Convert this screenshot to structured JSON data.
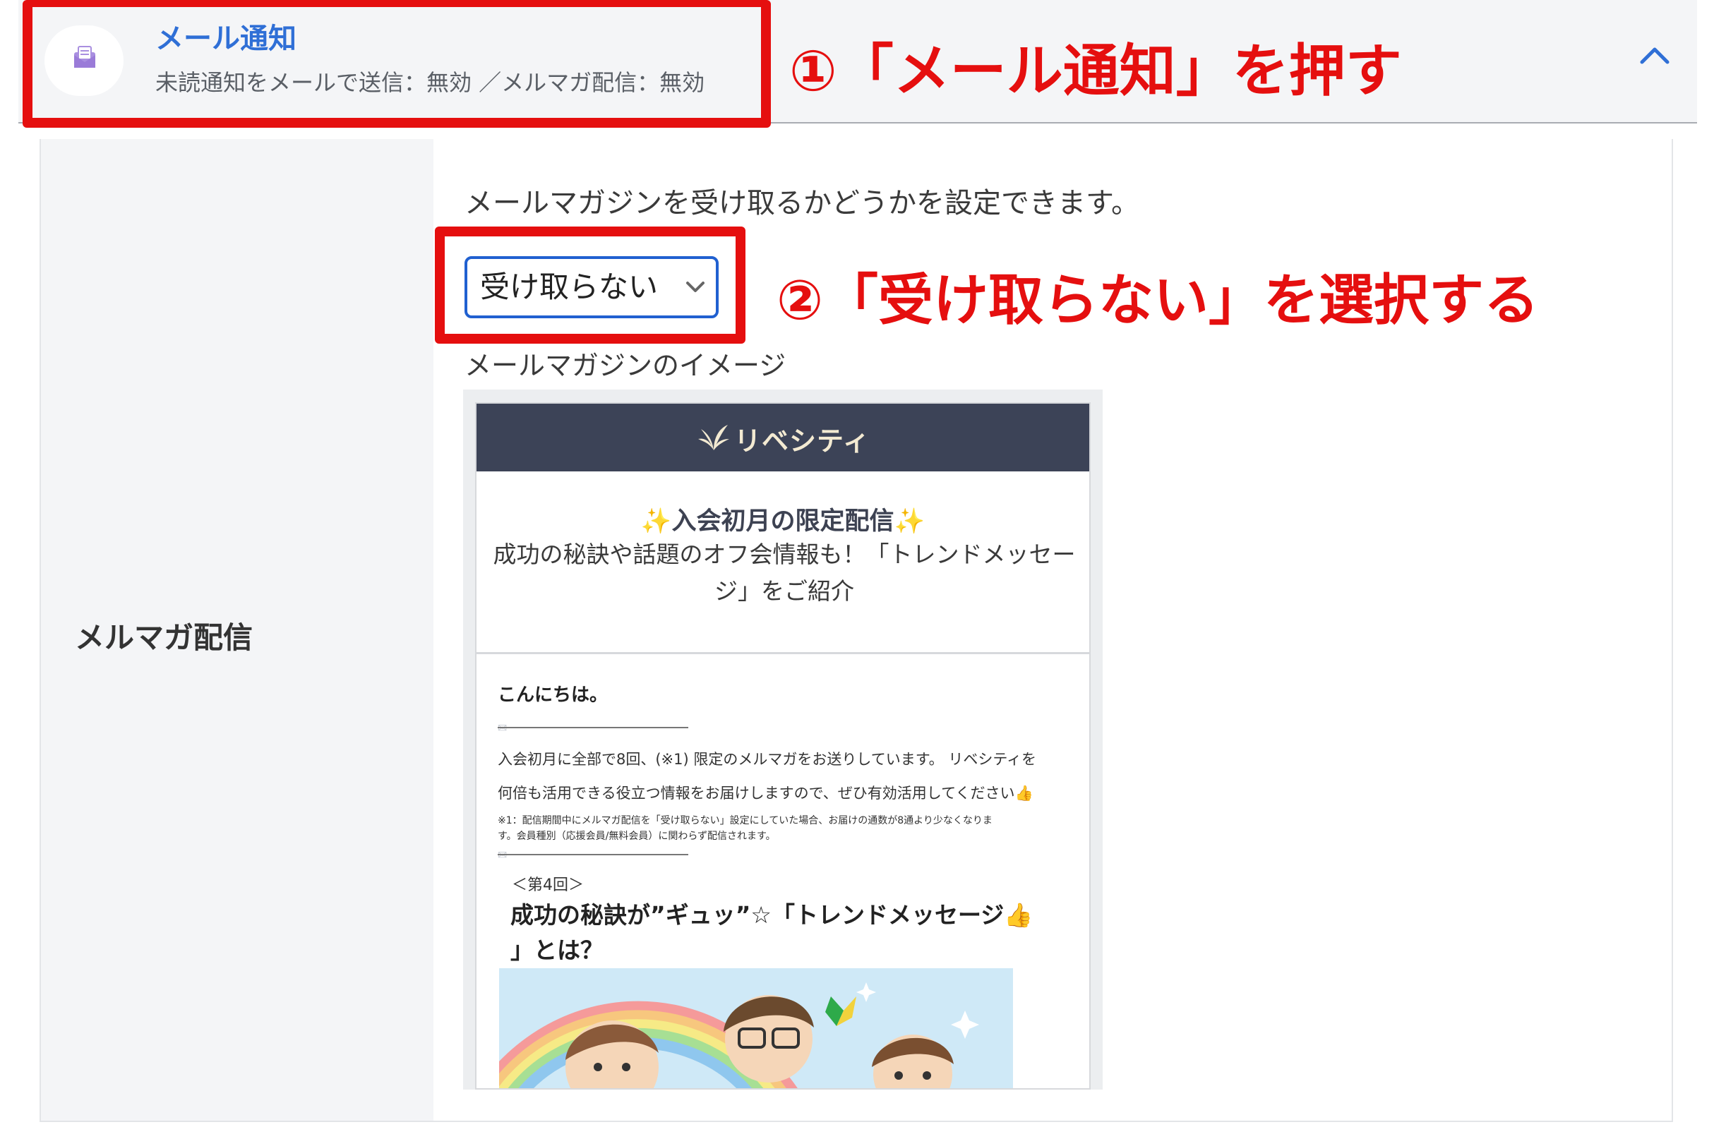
{
  "accordion": {
    "title": "メール通知",
    "subtitle": "未読通知をメールで送信：無効 ／メルマガ配信：無効"
  },
  "annotations": {
    "step1": "①「メール通知」を押す",
    "step2": "②「受け取らない」を選択する",
    "color": "#e50f0f"
  },
  "newsletter": {
    "label": "メルマガ配信",
    "description": "メールマガジンを受け取るかどうかを設定できます。",
    "select_value": "受け取らない",
    "image_caption": "メールマガジンのイメージ"
  },
  "preview": {
    "logo_text": "リベシティ",
    "headline": "✨入会初月の限定配信✨",
    "subtitle": "成功の秘訣や話題のオフ会情報も！「トレンドメッセージ」をご紹介",
    "greeting": "こんにちは。",
    "body_line1": "入会初月に全部で8回、(※1) 限定のメルマガをお送りしています。 リベシティを",
    "body_line2": "何倍も活用できる役立つ情報をお届けしますので、ぜひ有効活用してください👍",
    "note_line1": "※1：配信期間中にメルマガ配信を「受け取らない」設定にしていた場合、お届けの通数が8通より少なくなりま",
    "note_line2": "す。会員種別（応援会員/無料会員）に関わらず配信されます。",
    "issue_no": "＜第4回＞",
    "title_line1": "成功の秘訣が”ギュッ”☆「トレンドメッセージ👍",
    "title_line2": "」とは？"
  },
  "colors": {
    "accent_blue": "#2f6fd6",
    "header_bg": "#f4f5f7",
    "preview_header": "#3c4357"
  }
}
